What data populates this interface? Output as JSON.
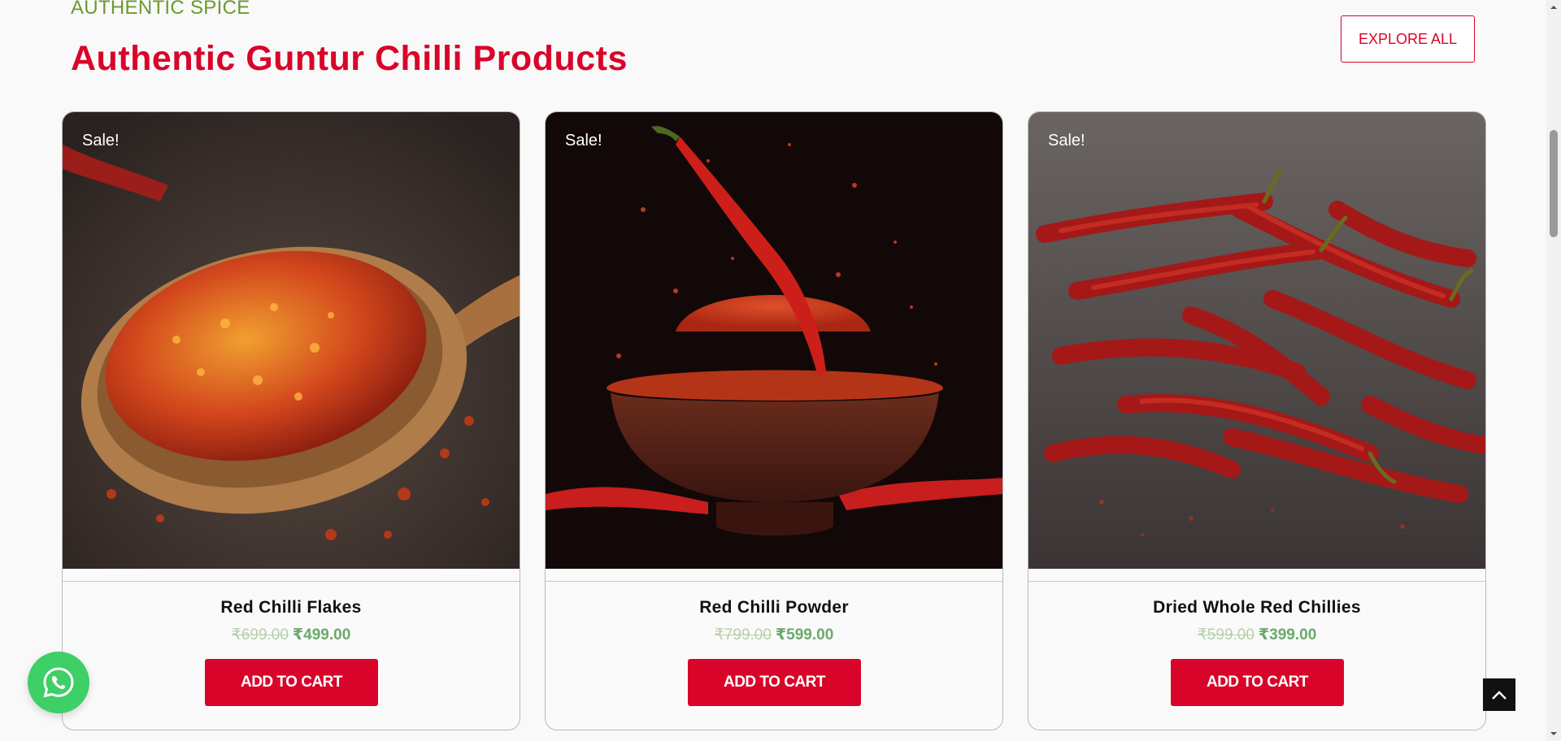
{
  "section": {
    "eyebrow": "AUTHENTIC SPICE",
    "title": "Authentic Guntur Chilli Products",
    "explore_label": "EXPLORE ALL"
  },
  "products": [
    {
      "name": "Red Chilli Flakes",
      "badge": "Sale!",
      "old_price": "₹699.00",
      "price": "₹499.00",
      "cta": "ADD TO CART",
      "image": "chilli-flakes-in-wooden-spoon"
    },
    {
      "name": "Red Chilli Powder",
      "badge": "Sale!",
      "old_price": "₹799.00",
      "price": "₹599.00",
      "cta": "ADD TO CART",
      "image": "chilli-powder-in-bowl"
    },
    {
      "name": "Dried Whole Red Chillies",
      "badge": "Sale!",
      "old_price": "₹599.00",
      "price": "₹399.00",
      "cta": "ADD TO CART",
      "image": "pile-of-dried-red-chillies"
    }
  ],
  "floating": {
    "whatsapp_icon": "whatsapp-icon",
    "back_to_top_icon": "chevron-up-icon"
  },
  "colors": {
    "accent": "#d90429",
    "eyebrow": "#6a9a2e",
    "price": "#6ca86c",
    "whatsapp": "#3ecf67"
  }
}
